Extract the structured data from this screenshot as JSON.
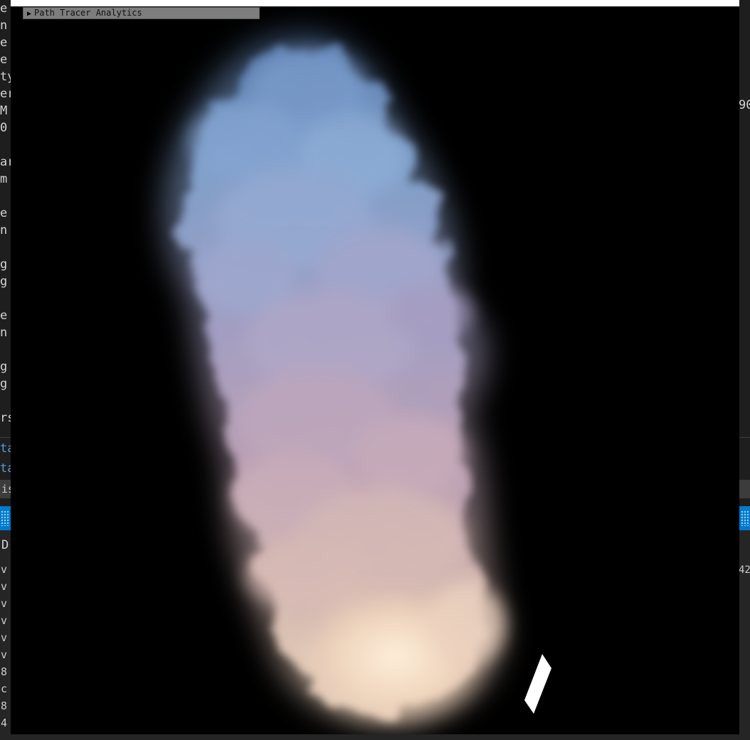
{
  "window": {
    "analytics_panel_title": "Path Tracer Analytics",
    "collapse_arrow": "▶"
  },
  "editor": {
    "left_fragments": [
      "e",
      "n",
      "e",
      "e",
      "ty",
      "er",
      "M",
      "0",
      "",
      "ar",
      "m",
      "",
      "e",
      "n",
      "",
      "g",
      "g",
      "",
      "e",
      "n",
      "",
      "g",
      "g",
      "",
      "rs"
    ],
    "blue_fragments": [
      "ta",
      "ta"
    ],
    "input_fragment": "is",
    "panel_header_fragment": "D",
    "panel_fragments": [
      "v",
      "v",
      "v",
      "v",
      "v",
      "v",
      "8",
      "c",
      "8",
      "4"
    ],
    "right_fragments": [
      "90",
      "42"
    ]
  },
  "colors": {
    "editor_bg": "#1e1e1e",
    "status_bar": "#007acc",
    "render_bg": "#000000",
    "smoke_top": "#8aaed8",
    "smoke_mid": "#b9abc7",
    "smoke_bottom": "#f3dcc5"
  }
}
